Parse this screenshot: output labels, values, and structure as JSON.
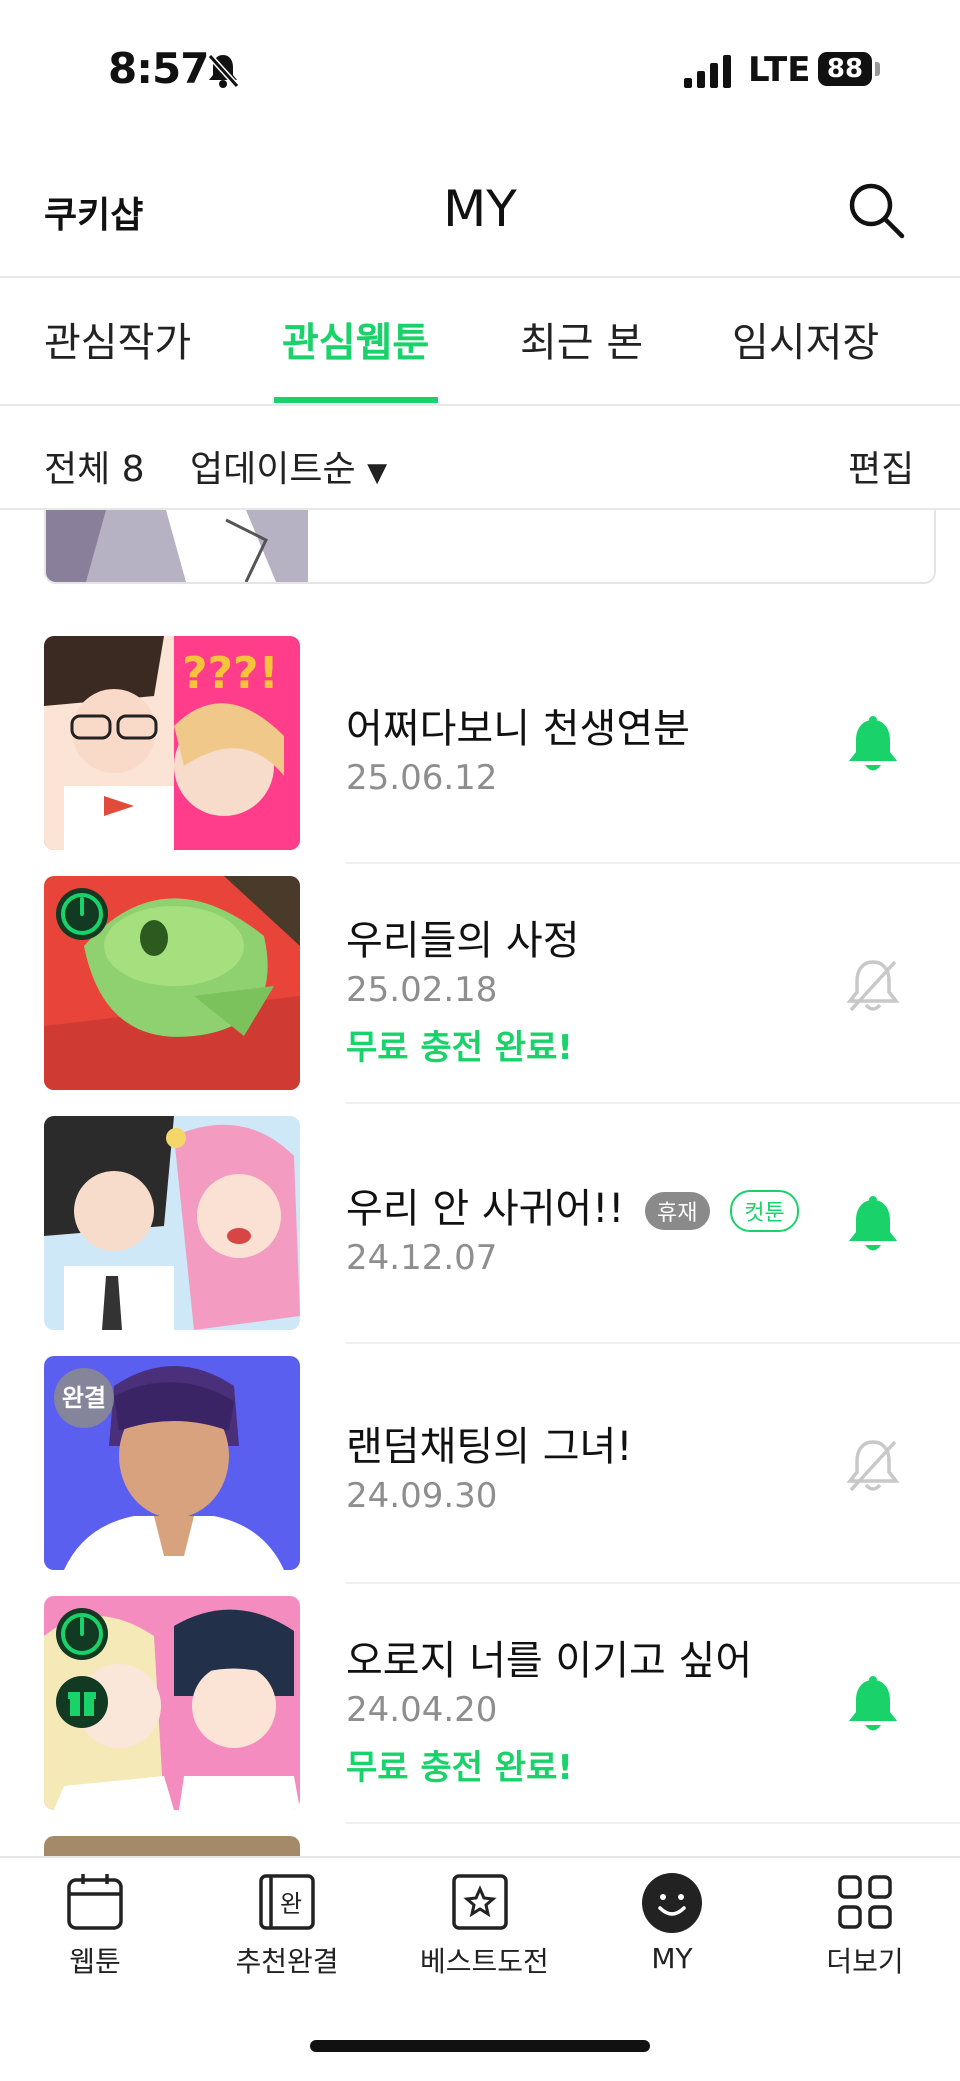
{
  "status": {
    "time": "8:57",
    "network": "LTE",
    "battery": "88"
  },
  "header": {
    "left_text": "쿠키샵",
    "title": "MY"
  },
  "tabs": [
    {
      "label": "관심작가",
      "active": false
    },
    {
      "label": "관심웹툰",
      "active": true
    },
    {
      "label": "최근 본",
      "active": false
    },
    {
      "label": "임시저장",
      "active": false
    }
  ],
  "filter": {
    "total": "전체 8",
    "sort": "업데이트순",
    "edit": "편집"
  },
  "items": [
    {
      "title": "어쩌다보니 천생연분",
      "date": "25.06.12",
      "promo": "",
      "bell": "on",
      "thumb_corner": ""
    },
    {
      "title": "우리들의 사정",
      "date": "25.02.18",
      "promo": "무료 충전 완료!",
      "bell": "off",
      "thumb_corner": "timer-icon"
    },
    {
      "title": "우리 안 사귀어!!",
      "date": "24.12.07",
      "promo": "",
      "bell": "on",
      "badges": [
        "휴재",
        "컷툰"
      ],
      "thumb_corner": ""
    },
    {
      "title": "랜덤채팅의 그녀!",
      "date": "24.09.30",
      "promo": "",
      "bell": "off",
      "thumb_corner_label": "완결"
    },
    {
      "title": "오로지 너를 이기고 싶어",
      "date": "24.04.20",
      "promo": "무료 충전 완료!",
      "bell": "on",
      "thumb_corner": "timer-icon"
    }
  ],
  "nav": [
    {
      "label": "웹툰",
      "icon": "calendar-icon"
    },
    {
      "label": "추천완결",
      "icon": "book-complete-icon",
      "icon_text": "완"
    },
    {
      "label": "베스트도전",
      "icon": "star-box-icon"
    },
    {
      "label": "MY",
      "icon": "smile-icon",
      "active": true
    },
    {
      "label": "더보기",
      "icon": "grid-icon"
    }
  ],
  "colors": {
    "accent": "#19d26a",
    "text": "#111111",
    "muted": "#8e8e8e"
  }
}
